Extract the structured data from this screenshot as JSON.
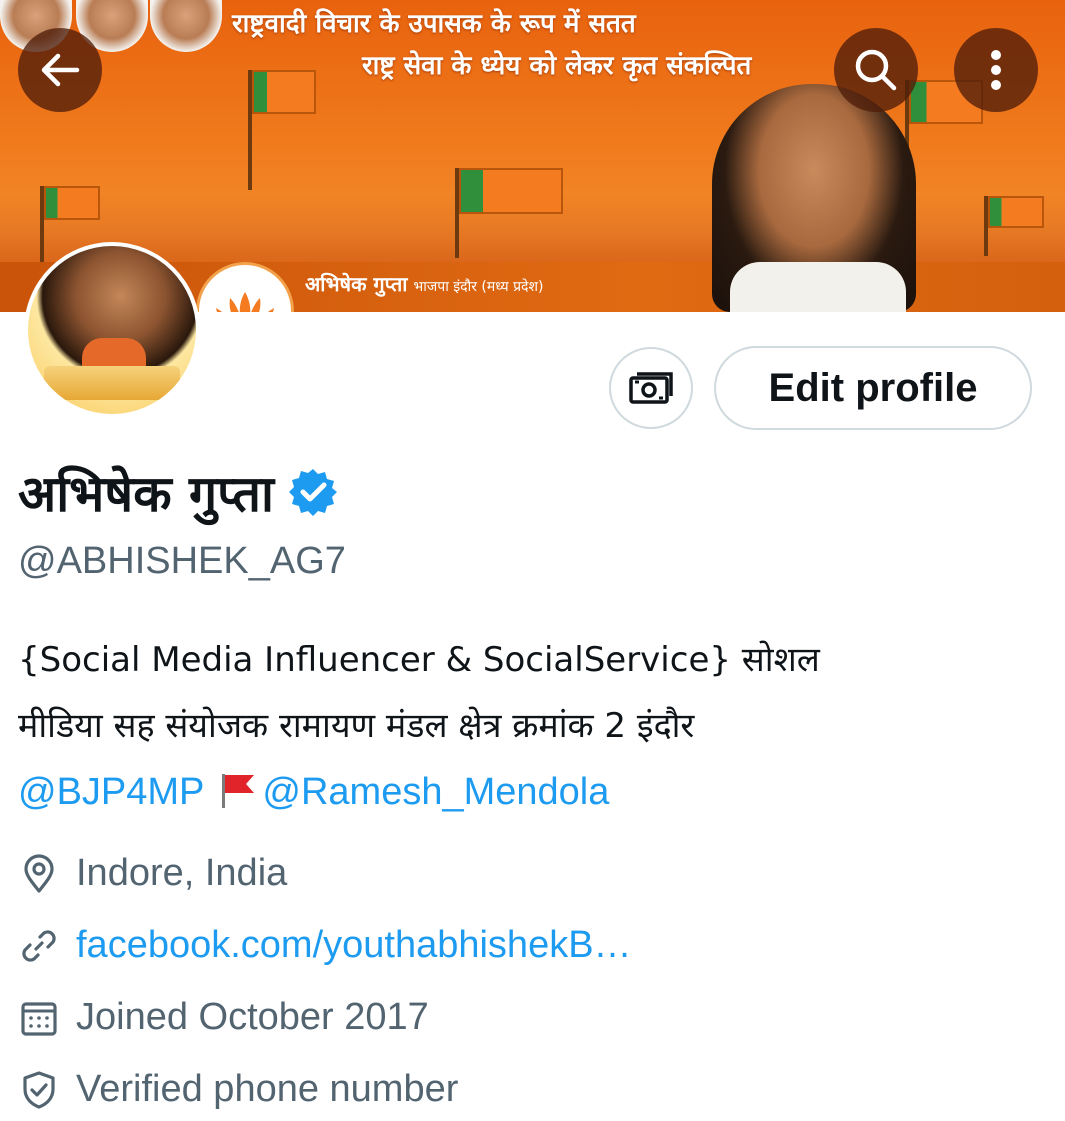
{
  "banner": {
    "line1": "राष्ट्रवादी विचार के उपासक के रूप में सतत",
    "line2": "राष्ट्र सेवा के ध्येय को लेकर कृत संकल्पित",
    "caption_name": "अभिषेक गुप्ता",
    "caption_sub": "भाजपा इंदौर (मध्य प्रदेश)"
  },
  "toolbar": {
    "back_icon": "arrow-left-icon",
    "search_icon": "search-icon",
    "more_icon": "more-vertical-icon"
  },
  "actions": {
    "professional_icon": "money-icon",
    "edit_profile_label": "Edit profile"
  },
  "profile": {
    "display_name": "अभिषेक गुप्ता",
    "handle": "@ABHISHEK_AG7",
    "bio": {
      "line1": "{Social Media Influencer & SocialService}  सोशल",
      "line2": "मीडिया सह संयोजक रामायण मंडल क्षेत्र क्रमांक 2 इंदौर",
      "mention1": "@BJP4MP",
      "mention2": "@Ramesh_Mendola"
    },
    "location": "Indore, India",
    "website": "facebook.com/youthabhishekB…",
    "joined": "Joined October 2017",
    "verified_phone": "Verified phone number"
  },
  "colors": {
    "accent": "#1d9bf0",
    "secondary_text": "#536471",
    "banner_orange": "#f07a1c"
  }
}
